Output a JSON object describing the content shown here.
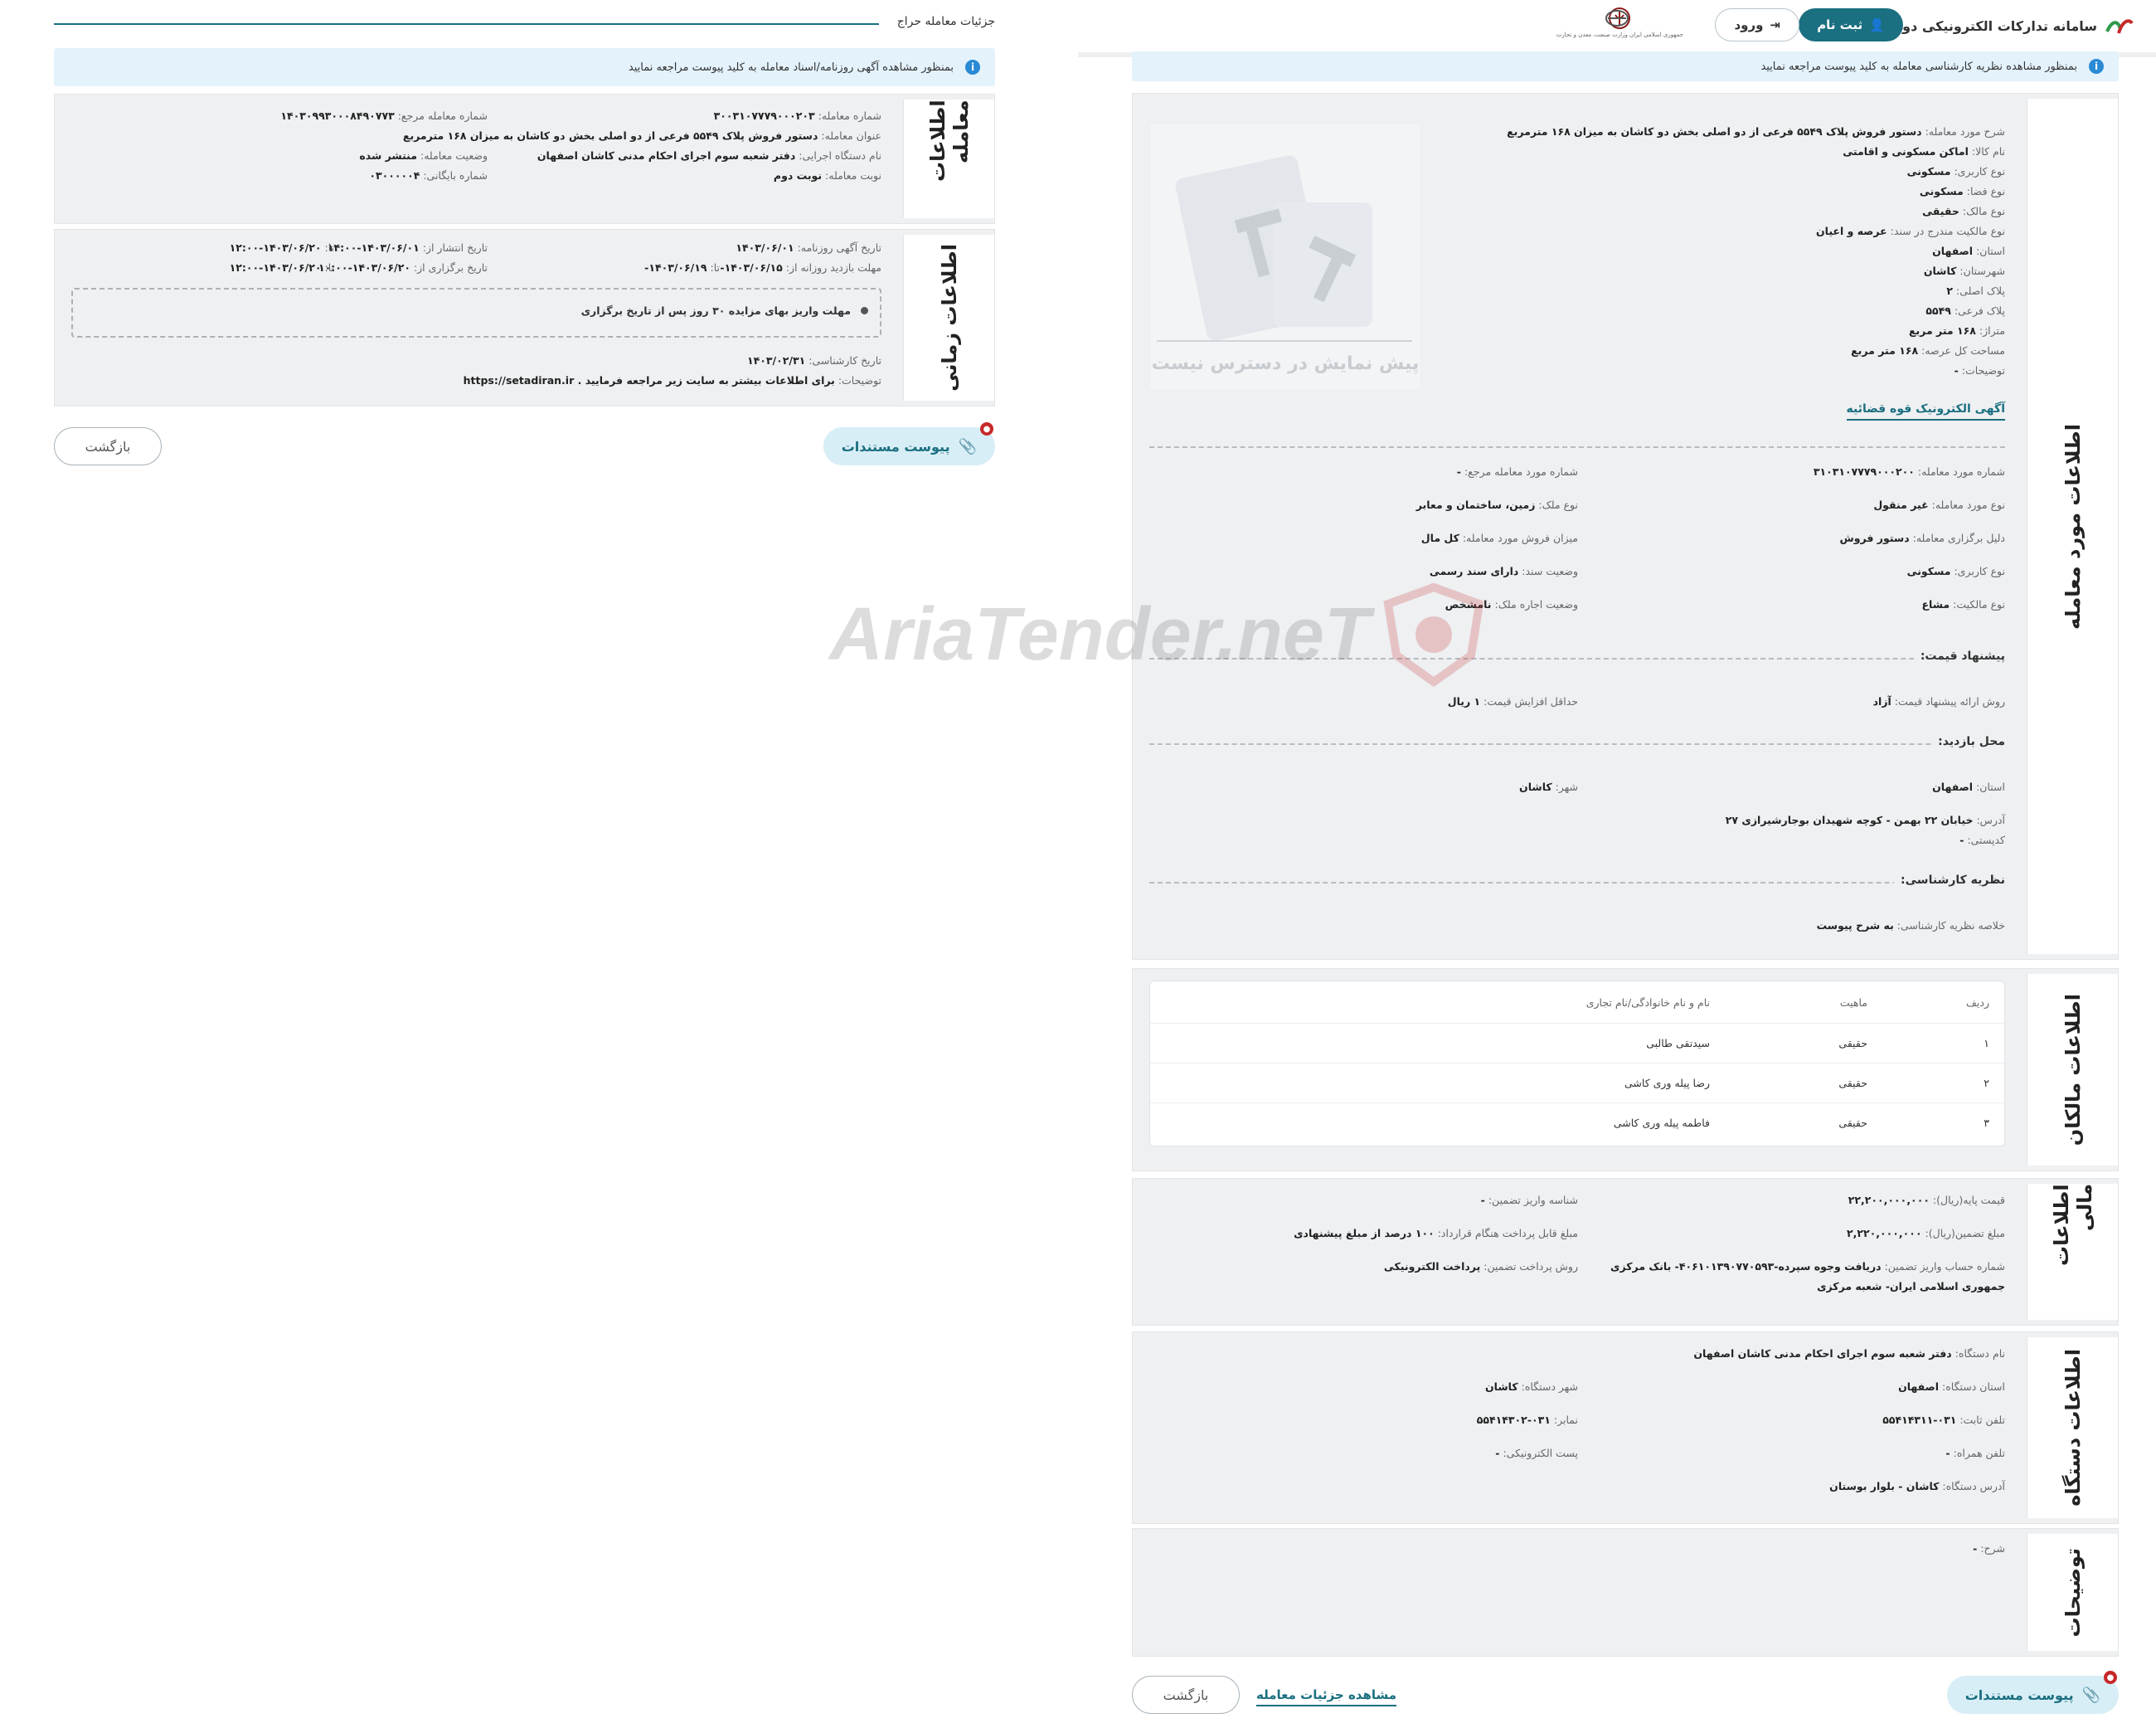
{
  "left": {
    "title": "جزئیات معامله حراج",
    "notice": "بمنظور مشاهده آگهی روزنامه/اسناد معامله به کلید پیوست مراجعه نمایید",
    "deal_info": {
      "title": "اطلاعات معامله",
      "deal_number_label": "شماره معامله:",
      "deal_number": "۳۰۰۳۱۰۷۷۷۹۰۰۰۲۰۳",
      "ref_number_label": "شماره معامله مرجع:",
      "ref_number": "۱۴۰۳۰۹۹۳۰۰۰۸۴۹۰۷۷۳",
      "subject_label": "عنوان معامله:",
      "subject": "دستور فروش پلاک ۵۵۴۹ فرعی از دو اصلی بخش دو کاشان به میزان ۱۶۸ مترمربع",
      "org_label": "نام دستگاه اجرایی:",
      "org": "دفتر شعبه سوم اجرای احکام مدنی کاشان اصفهان",
      "status_label": "وضعیت معامله:",
      "status": "منتشر شده",
      "turn_label": "نوبت معامله:",
      "turn": "نوبت دوم",
      "archive_label": "شماره بایگانی:",
      "archive": "۰۳۰۰۰۰۰۴"
    },
    "time_info": {
      "title": "اطلاعات زمانی",
      "news_date_label": "تاریخ آگهی روزنامه:",
      "news_date": "۱۴۰۳/۰۶/۰۱",
      "publish_label": "تاریخ انتشار از:",
      "publish_from": "۱۴۰۳/۰۶/۰۱-۱۴:۰۰",
      "to_label": "تا:",
      "publish_to": "۱۴۰۳/۰۶/۲۰-۱۲:۰۰",
      "visit_label": "مهلت بازدید روزانه از:",
      "visit_from": "۱۴۰۳/۰۶/۱۵-",
      "visit_to": "۱۴۰۳/۰۶/۱۹-",
      "hold_label": "تاریخ برگزاری از:",
      "hold_from": "۱۴۰۳/۰۶/۲۰-۱۰:۰۰",
      "hold_to": "۱۴۰۳/۰۶/۲۰-۱۲:۰۰",
      "note": "مهلت واریز بهای مزایده ۳۰ روز پس از تاریخ برگزاری",
      "expert_label": "تاریخ کارشناسی:",
      "expert_date": "۱۴۰۳/۰۲/۳۱",
      "desc_label": "توضیحات:",
      "desc": "برای اطلاعات بیشتر به سایت زیر مراجعه فرمایید . https://setadiran.ir"
    },
    "attach_label": "پیوست مستندات",
    "back_label": "بازگشت"
  },
  "right": {
    "app_title": "سامانه تدارکات الکترونیکی دولت",
    "register_label": "ثبت نام",
    "login_label": "ورود",
    "seal1": "جمهوری اسلامی ایران\nوزارت صنعت، معدن و تجارت",
    "notice": "بمنظور مشاهده نظریه کارشناسی معامله به کلید پیوست مراجعه نمایید",
    "item": {
      "title": "اطلاعات مورد معامله",
      "img_caption": "پیش نمایش در دسترس نیست",
      "lines": [
        {
          "l": "شرح مورد معامله:",
          "v": "دستور فروش پلاک ۵۵۴۹ فرعی از دو اصلی بخش دو کاشان به میزان ۱۶۸ مترمربع"
        },
        {
          "l": "نام کالا:",
          "v": "اماکن مسکونی و اقامتی"
        },
        {
          "l": "نوع کاربری:",
          "v": "مسکونی"
        },
        {
          "l": "نوع فضا:",
          "v": "مسکونی"
        },
        {
          "l": "نوع مالک:",
          "v": "حقیقی"
        },
        {
          "l": "نوع مالکیت مندرج در سند:",
          "v": "عرصه و اعیان"
        },
        {
          "l": "استان:",
          "v": "اصفهان"
        },
        {
          "l": "شهرستان:",
          "v": "کاشان"
        },
        {
          "l": "پلاک اصلی:",
          "v": "۲"
        },
        {
          "l": "پلاک فرعی:",
          "v": "۵۵۴۹"
        },
        {
          "l": "متراژ:",
          "v": "۱۶۸ متر مربع"
        },
        {
          "l": "مساحت کل عرصه:",
          "v": "۱۶۸ متر مربع"
        },
        {
          "l": "توضیحات:",
          "v": "-"
        }
      ],
      "court_link": "آگهی الکترونیک قوه قضائیه",
      "item_number_label": "شماره مورد معامله:",
      "item_number": "۳۱۰۳۱۰۷۷۷۹۰۰۰۲۰۰",
      "ref_item_label": "شماره مورد معامله مرجع:",
      "ref_item": "-",
      "item_type_label": "نوع مورد معامله:",
      "item_type": "غیر منقول",
      "prop_type_label": "نوع ملک:",
      "prop_type": "زمین، ساختمان و معابر",
      "reason_label": "دلیل برگزاری معامله:",
      "reason": "دستور فروش",
      "sale_amount_label": "میزان فروش مورد معامله:",
      "sale_amount": "کل مال",
      "usage_label": "نوع کاربری:",
      "usage": "مسکونی",
      "doc_status_label": "وضعیت سند:",
      "doc_status": "دارای سند رسمی",
      "ownership_label": "نوع مالکیت:",
      "ownership": "مشاع",
      "lease_label": "وضعیت اجاره ملک:",
      "lease": "نامشخص",
      "price_head": "پیشنهاد قیمت:",
      "method_label": "روش ارائه پیشنهاد قیمت:",
      "method": "آزاد",
      "min_inc_label": "حداقل افزایش قیمت:",
      "min_inc": "۱ ریال",
      "visit_head": "محل بازدید:",
      "v_prov_label": "استان:",
      "v_prov": "اصفهان",
      "v_city_label": "شهر:",
      "v_city": "کاشان",
      "addr_label": "آدرس:",
      "addr": "خیابان ۲۲ بهمن - کوچه شهیدان بوجارشیرازی ۲۷",
      "postal_label": "کدپستی:",
      "postal": "-",
      "expert_head": "نظریه کارشناسی:",
      "expert_sum_label": "خلاصه نظریه کارشناسی:",
      "expert_sum": "به شرح پیوست"
    },
    "owners": {
      "title": "اطلاعات مالکان",
      "cols": [
        "ردیف",
        "ماهیت",
        "نام و نام خانوادگی/نام تجاری"
      ],
      "rows": [
        [
          "۱",
          "حقیقی",
          "سیدتقی طالبی"
        ],
        [
          "۲",
          "حقیقی",
          "رضا پیله وری کاشی"
        ],
        [
          "۳",
          "حقیقی",
          "فاطمه پیله وری کاشی"
        ]
      ]
    },
    "finance": {
      "title": "اطلاعات مالی",
      "base_label": "قیمت پایه(ریال):",
      "base": "۲۲,۲۰۰,۰۰۰,۰۰۰",
      "dep_id_label": "شناسه واریز تضمین:",
      "dep_id": "-",
      "guar_label": "مبلغ تضمین(ریال):",
      "guar": "۲,۲۲۰,۰۰۰,۰۰۰",
      "pay_label": "مبلغ قابل پرداخت هنگام قرارداد:",
      "pay": "۱۰۰ درصد از مبلغ پیشنهادی",
      "acct_label": "شماره حساب واریز تضمین:",
      "acct": "دریافت وجوه سپرده-۴۰۶۱۰۱۳۹۰۷۷۰۵۹۳- بانک مرکزی",
      "acct2": "جمهوری اسلامی ایران- شعبه مرکزی",
      "method_label": "روش پرداخت تضمین:",
      "method": "پرداخت الکترونیکی"
    },
    "org": {
      "title": "اطلاعات دستگاه",
      "name_label": "نام دستگاه:",
      "name": "دفتر شعبه سوم اجرای احکام مدنی کاشان اصفهان",
      "prov_label": "استان دستگاه:",
      "prov": "اصفهان",
      "city_label": "شهر دستگاه:",
      "city": "کاشان",
      "tel_label": "تلفن ثابت:",
      "tel": "۰۳۱-۵۵۴۱۴۳۱۱",
      "fax_label": "نمابر:",
      "fax": "۰۳۱-۵۵۴۱۴۳۰۲",
      "mob_label": "تلفن همراه:",
      "mob": "-",
      "mail_label": "پست الکترونیکی:",
      "mail": "-",
      "addr_label": "آدرس دستگاه:",
      "addr": "کاشان - بلوار بوستان"
    },
    "notes": {
      "title": "توضیحات",
      "desc_label": "شرح:",
      "desc": "-"
    },
    "attach_label": "پیوست مستندات",
    "details_link": "مشاهده جزئیات معامله",
    "back_label": "بازگشت"
  },
  "watermark": "AriaTender.neT",
  "colors": {
    "primary": "#1a6f80",
    "panel": "#eef0f2",
    "info": "#e3f2fb",
    "badge": "#c62828"
  }
}
